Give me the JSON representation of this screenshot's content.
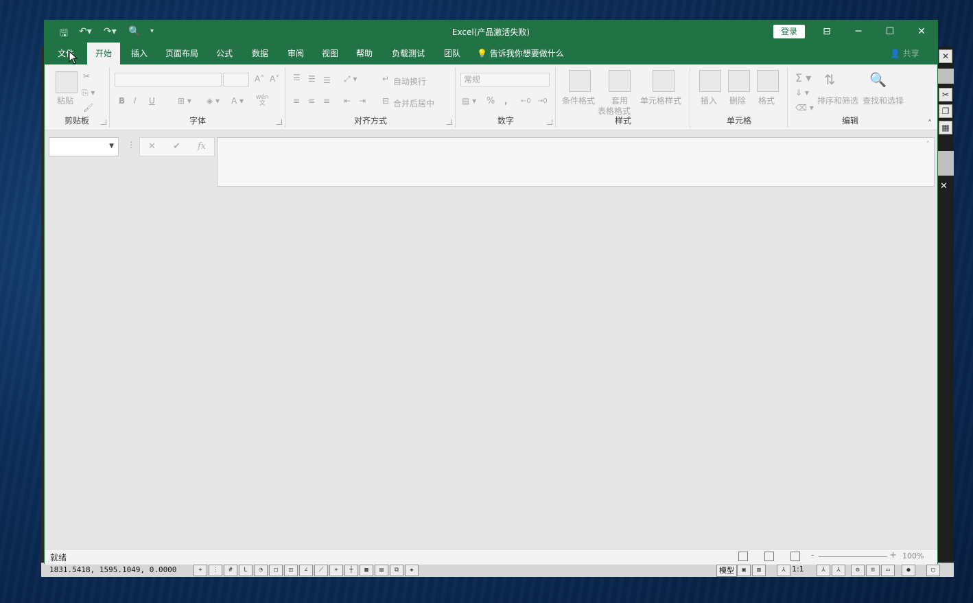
{
  "excel": {
    "title": "Excel(产品激活失败)",
    "login_label": "登录",
    "tabs": [
      "文件",
      "开始",
      "插入",
      "页面布局",
      "公式",
      "数据",
      "审阅",
      "视图",
      "帮助",
      "负载测试",
      "团队"
    ],
    "tell_me": "告诉我你想要做什么",
    "share": "共享",
    "ribbon": {
      "clipboard": {
        "label": "剪贴板",
        "paste": "粘贴"
      },
      "font": {
        "label": "字体",
        "bold": "B",
        "italic": "I",
        "underline": "U",
        "wen": "wén\n文"
      },
      "alignment": {
        "label": "对齐方式",
        "wrap": "自动换行",
        "merge": "合并后居中"
      },
      "number": {
        "label": "数字",
        "format": "常规",
        "percent": "%",
        "comma": ","
      },
      "styles": {
        "label": "样式",
        "conditional": "条件格式",
        "table1": "套用",
        "table2": "表格格式",
        "cell_styles": "单元格样式"
      },
      "cells": {
        "label": "单元格",
        "insert": "插入",
        "delete": "删除",
        "format": "格式"
      },
      "editing": {
        "label": "编辑",
        "sort": "排序和筛选",
        "find": "查找和选择"
      }
    },
    "status": {
      "ready": "就绪",
      "zoom": "100%"
    }
  },
  "cad": {
    "coords": "1831.5418,  1595.1049,  0.0000",
    "model": "模型",
    "scale": "1:1"
  },
  "colors": {
    "excel_green": "#217346"
  }
}
